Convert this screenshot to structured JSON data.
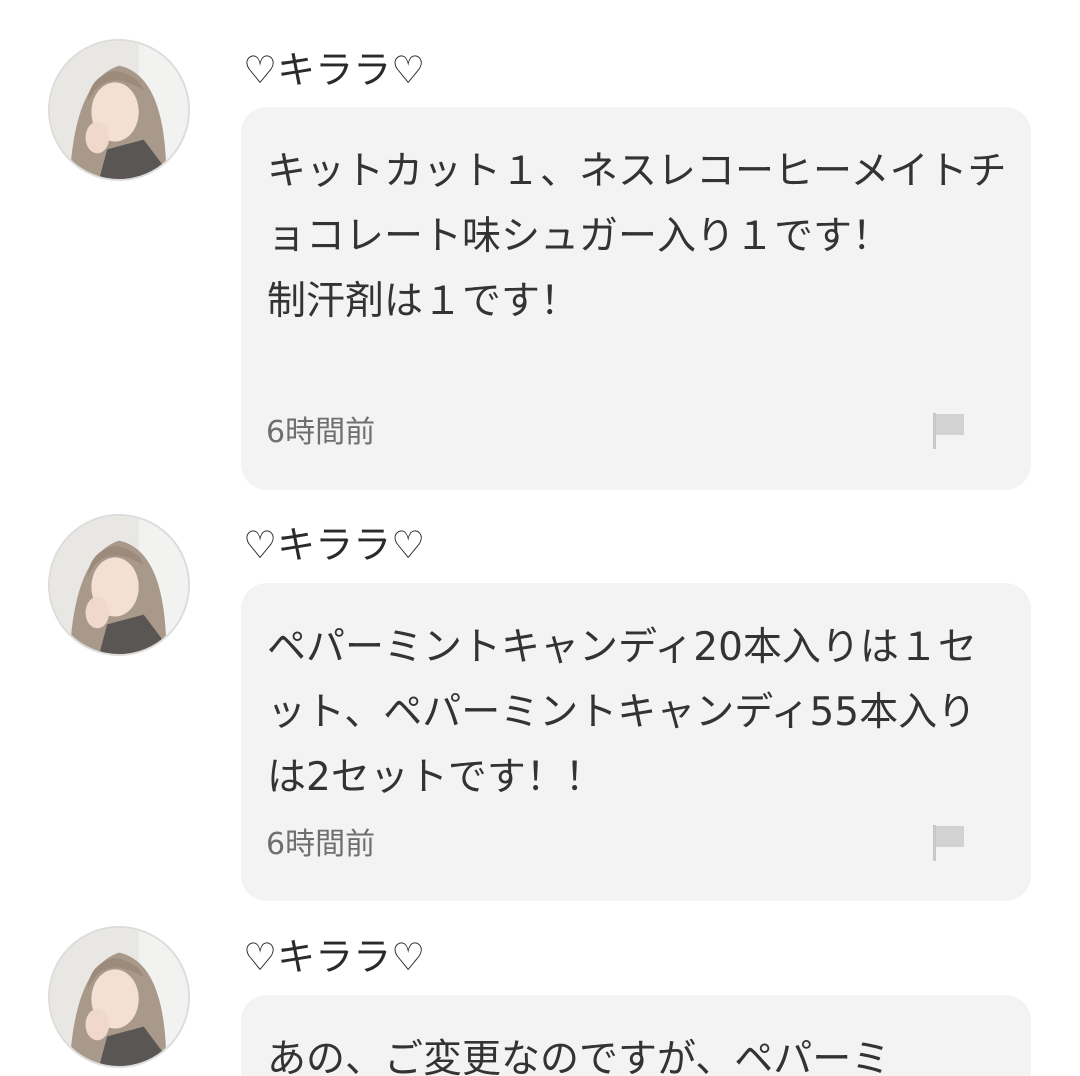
{
  "comments": [
    {
      "username": "♡キララ♡",
      "text": "キットカット１、ネスレコーヒーメイトチョコレート味シュガー入り１です！\n制汗剤は１です！",
      "time": "6時間前",
      "avatar_icon": "user-avatar",
      "report_icon": "flag-icon"
    },
    {
      "username": "♡キララ♡",
      "text": "ペパーミントキャンディ20本入りは１セット、ペパーミントキャンディ55本入りは2セットです！！",
      "time": "6時間前",
      "avatar_icon": "user-avatar",
      "report_icon": "flag-icon"
    },
    {
      "username": "♡キララ♡",
      "text": "あの、ご変更なのですが、ペパーミ",
      "time": "",
      "avatar_icon": "user-avatar",
      "report_icon": "flag-icon"
    }
  ],
  "colors": {
    "bubble_bg": "#f3f3f3",
    "text": "#333333",
    "timestamp": "#6f6f6f",
    "flag": "#c8c8c8"
  }
}
